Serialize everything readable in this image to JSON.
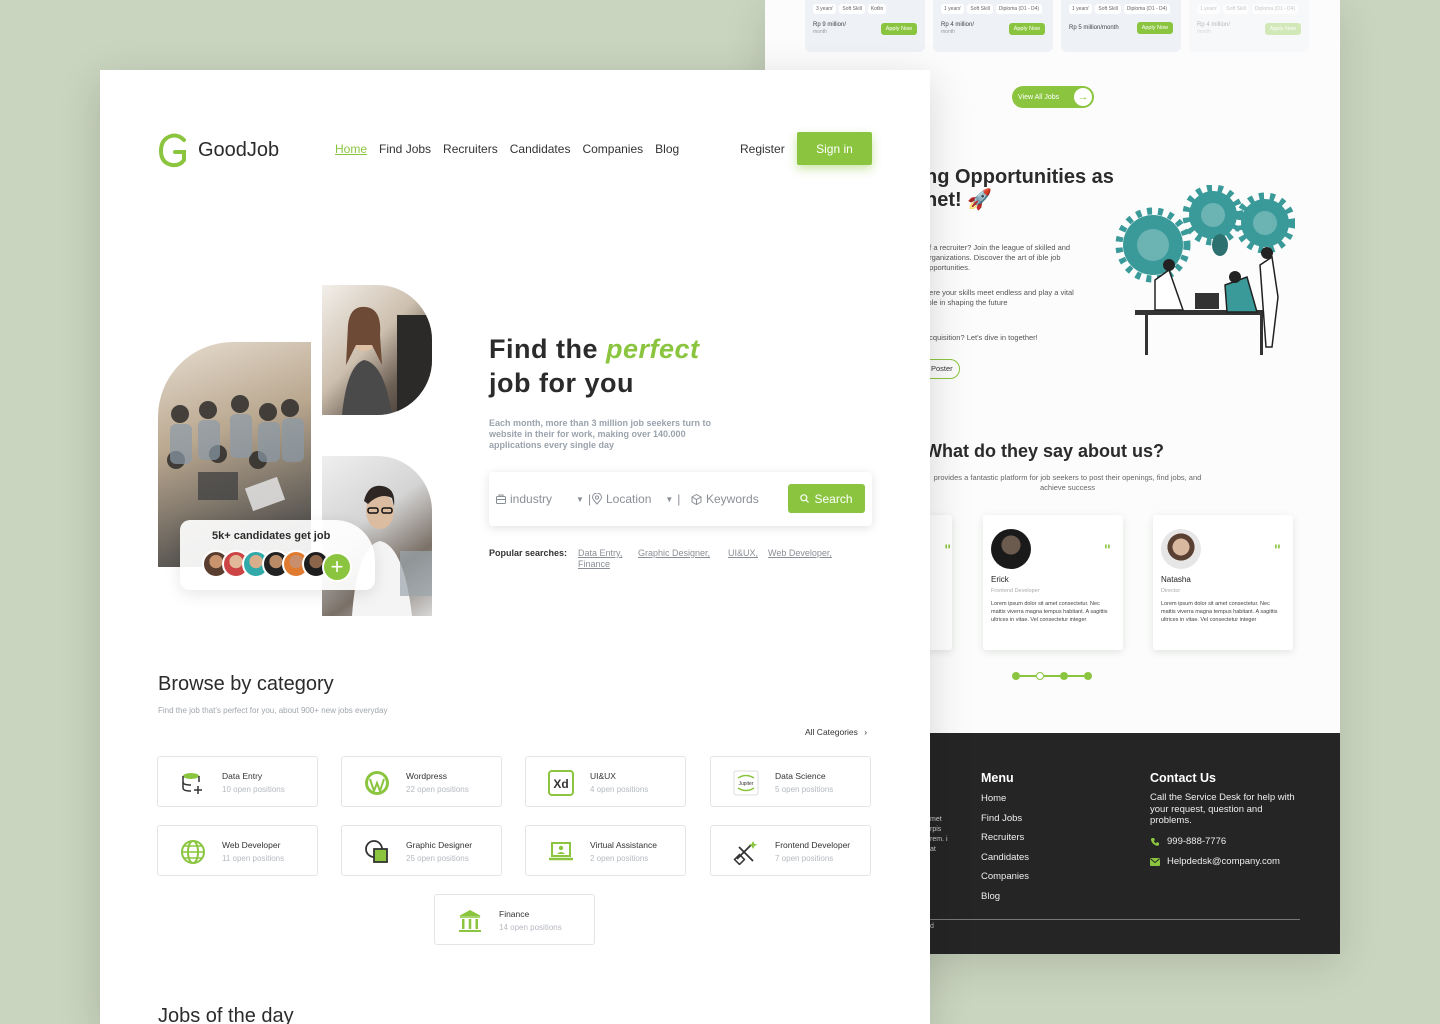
{
  "back": {
    "job_cards": [
      {
        "tags": [
          "3 years'",
          "Soft Skill",
          "Kotlin"
        ],
        "salary": "Rp 9 million/",
        "period": "month",
        "apply": "Apply Now"
      },
      {
        "tags": [
          "1 years'",
          "Soft Skill",
          "Diploma (D1 - D4)"
        ],
        "salary": "Rp 4 million/",
        "period": "month",
        "apply": "Apply Now"
      },
      {
        "tags": [
          "1 years'",
          "Soft Skill",
          "Diploma (D1 - D4)"
        ],
        "salary": "Rp 5 million/month",
        "period": "",
        "apply": "Apply Now"
      },
      {
        "tags": [
          "1 years'",
          "Soft Skill",
          "Diploma (D1 - D4)"
        ],
        "salary": "Rp 4 million/",
        "period": "month",
        "apply": "Apply Now"
      }
    ],
    "view_all": "View All Jobs",
    "opportunities": {
      "title_line1": "ng Opportunities as",
      "title_line2": "net! 🚀",
      "para1": "of a recruiter? Join the league of skilled and organizations. Discover the art of ible job opportunities.",
      "para2": "here your skills meet endless and play a vital role in shaping the future",
      "para3": "acquisition? Let's dive in together!",
      "button": "Poster"
    },
    "testimonials": {
      "title": "What do they say about us?",
      "subtitle": "provides a fantastic platform for job seekers to post their openings, find jobs, and achieve success",
      "cards": [
        {
          "name": "Erick",
          "role": "Frontend Developer",
          "text": "Lorem ipsum dolor sit amet consectetur. Nec mattis viverra magna tempus habitant. A sagittis ultrices in vitae. Vel consectetur integer"
        },
        {
          "name": "Natasha",
          "role": "Director",
          "text": "Lorem ipsum dolor sit amet consectetur. Nec mattis viverra magna tempus habitant. A sagittis ultrices in vitae. Vel consectetur integer"
        }
      ]
    },
    "footer": {
      "menu_title": "Menu",
      "menu": [
        "Home",
        "Find Jobs",
        "Recruiters",
        "Candidates",
        "Companies",
        "Blog"
      ],
      "contact_title": "Contact Us",
      "contact_text": "Call the Service Desk for help with your request, question and problems.",
      "phone": "999-888-7776",
      "email": "Helpdedsk@company.com",
      "left_fragment": "met rpis rem. i at",
      "copyright_fragment": "d"
    }
  },
  "front": {
    "brand": "GoodJob",
    "nav": [
      "Home",
      "Find Jobs",
      "Recruiters",
      "Candidates",
      "Companies",
      "Blog"
    ],
    "register": "Register",
    "signin": "Sign in",
    "badge": "5k+ candidates get job",
    "hero": {
      "line1_a": "Find the ",
      "line1_b": "perfect",
      "line2": "job for you",
      "desc": "Each month, more than 3 million job seekers turn to website in their for work, making over 140.000 applications every single day"
    },
    "search": {
      "industry": "industry",
      "location": "Location",
      "keywords": "Keywords",
      "button": "Search"
    },
    "popular": {
      "label": "Popular searches:",
      "items": [
        "Data Entry,",
        "Graphic Designer,",
        "UI&UX,",
        "Web Developer,",
        "Finance"
      ]
    },
    "browse": {
      "title": "Browse by category",
      "subtitle": "Find the job that's perfect for you, about 900+ new jobs everyday",
      "all": "All Categories",
      "categories": [
        {
          "name": "Data Entry",
          "count": "10 open positions",
          "icon": "database-icon"
        },
        {
          "name": "Wordpress",
          "count": "22 open positions",
          "icon": "wordpress-icon"
        },
        {
          "name": "UI&UX",
          "count": "4 open positions",
          "icon": "xd-icon"
        },
        {
          "name": "Data Science",
          "count": "5 open positions",
          "icon": "jupyter-icon"
        },
        {
          "name": "Web Developer",
          "count": "11 open positions",
          "icon": "globe-icon"
        },
        {
          "name": "Graphic Designer",
          "count": "25 open positions",
          "icon": "shapes-icon"
        },
        {
          "name": "Virtual Assistance",
          "count": "2 open positions",
          "icon": "laptop-user-icon"
        },
        {
          "name": "Frontend Developer",
          "count": "7 open positions",
          "icon": "code-tools-icon"
        },
        {
          "name": "Finance",
          "count": "14 open positions",
          "icon": "bank-icon"
        }
      ]
    },
    "jobs_title": "Jobs of the day"
  },
  "colors": {
    "accent": "#8bc53f",
    "dark": "#252525",
    "background": "#c9d5bf"
  }
}
